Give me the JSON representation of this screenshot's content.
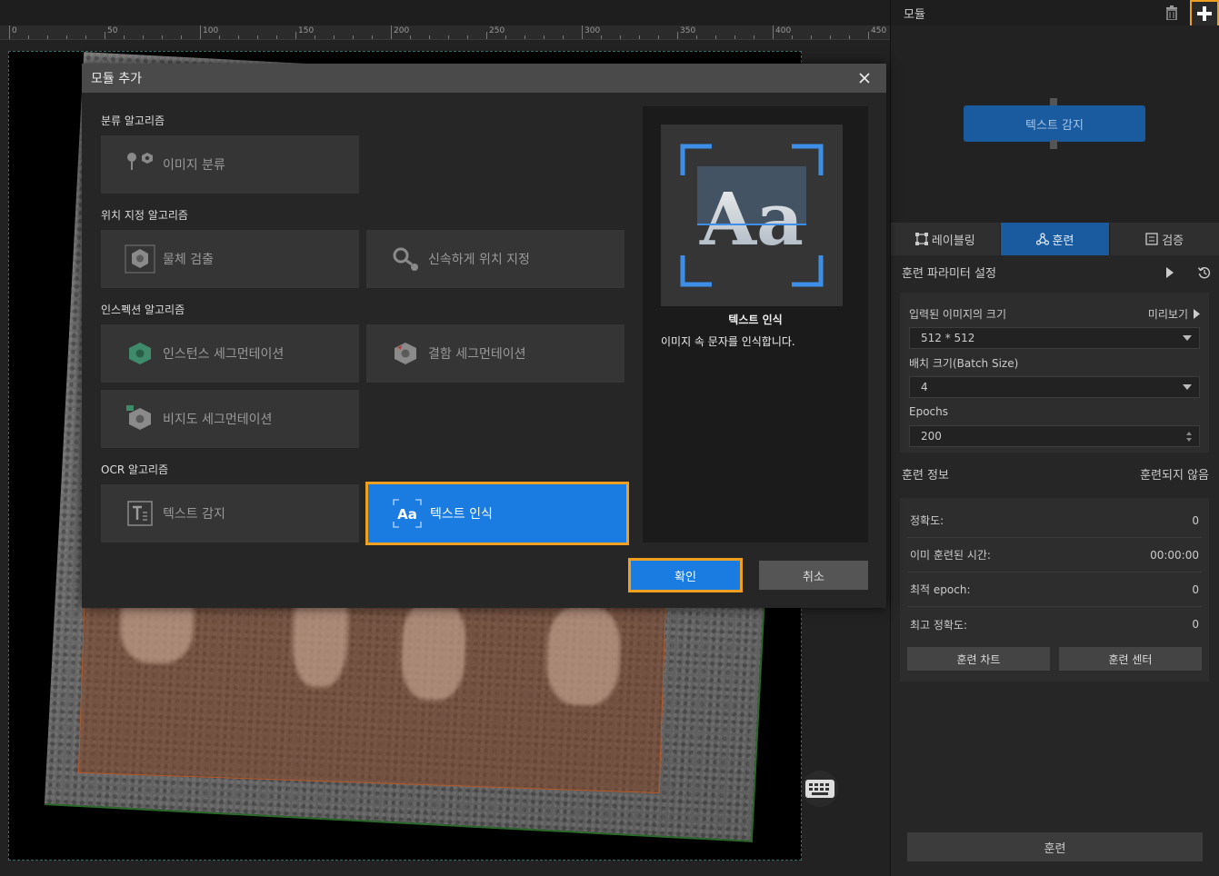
{
  "panel": {
    "title": "모듈",
    "flow_node": "텍스트 감지",
    "tabs": [
      {
        "label": "레이블링"
      },
      {
        "label": "훈련"
      },
      {
        "label": "검증"
      }
    ],
    "params_title": "훈련 파라미터 설정",
    "image_size_label": "입력된 이미지의 크기",
    "preview_label": "미리보기",
    "image_size_value": "512 * 512",
    "batch_label": "배치 크기(Batch Size)",
    "batch_value": "4",
    "epochs_label": "Epochs",
    "epochs_value": "200",
    "info_title": "훈련 정보",
    "info_status": "훈련되지 않음",
    "info_rows": [
      {
        "label": "정확도:",
        "value": "0"
      },
      {
        "label": "이미 훈련된 시간:",
        "value": "00:00:00"
      },
      {
        "label": "최적 epoch:",
        "value": "0"
      },
      {
        "label": "최고 정확도:",
        "value": "0"
      }
    ],
    "chart_btn": "훈련 차트",
    "center_btn": "훈련 센터",
    "train_btn": "훈련"
  },
  "ruler": {
    "labels": [
      "0",
      "50",
      "100",
      "150",
      "200",
      "250",
      "300",
      "350",
      "400",
      "450"
    ]
  },
  "dialog": {
    "title": "모듈 추가",
    "sections": {
      "classification": "분류 알고리즘",
      "locate": "위치 지정 알고리즘",
      "inspection": "인스펙션 알고리즘",
      "ocr": "OCR 알고리즘"
    },
    "modules": {
      "image_classification": "이미지 분류",
      "object_detection": "물체 검출",
      "fast_positioning": "신속하게 위치 지정",
      "instance_seg": "인스턴스 세그먼테이션",
      "defect_seg": "결함 세그먼테이션",
      "unsupervised_seg": "비지도 세그먼테이션",
      "text_detection": "텍스트 감지",
      "text_recognition": "텍스트 인식"
    },
    "preview": {
      "glyph": "Aa",
      "name": "텍스트 인식",
      "description": "이미지 속 문자를 인식합니다."
    },
    "ok": "확인",
    "cancel": "취소"
  },
  "colors": {
    "accent": "#1a7be0",
    "highlight": "#f0a020",
    "node": "#1a5a9e"
  }
}
